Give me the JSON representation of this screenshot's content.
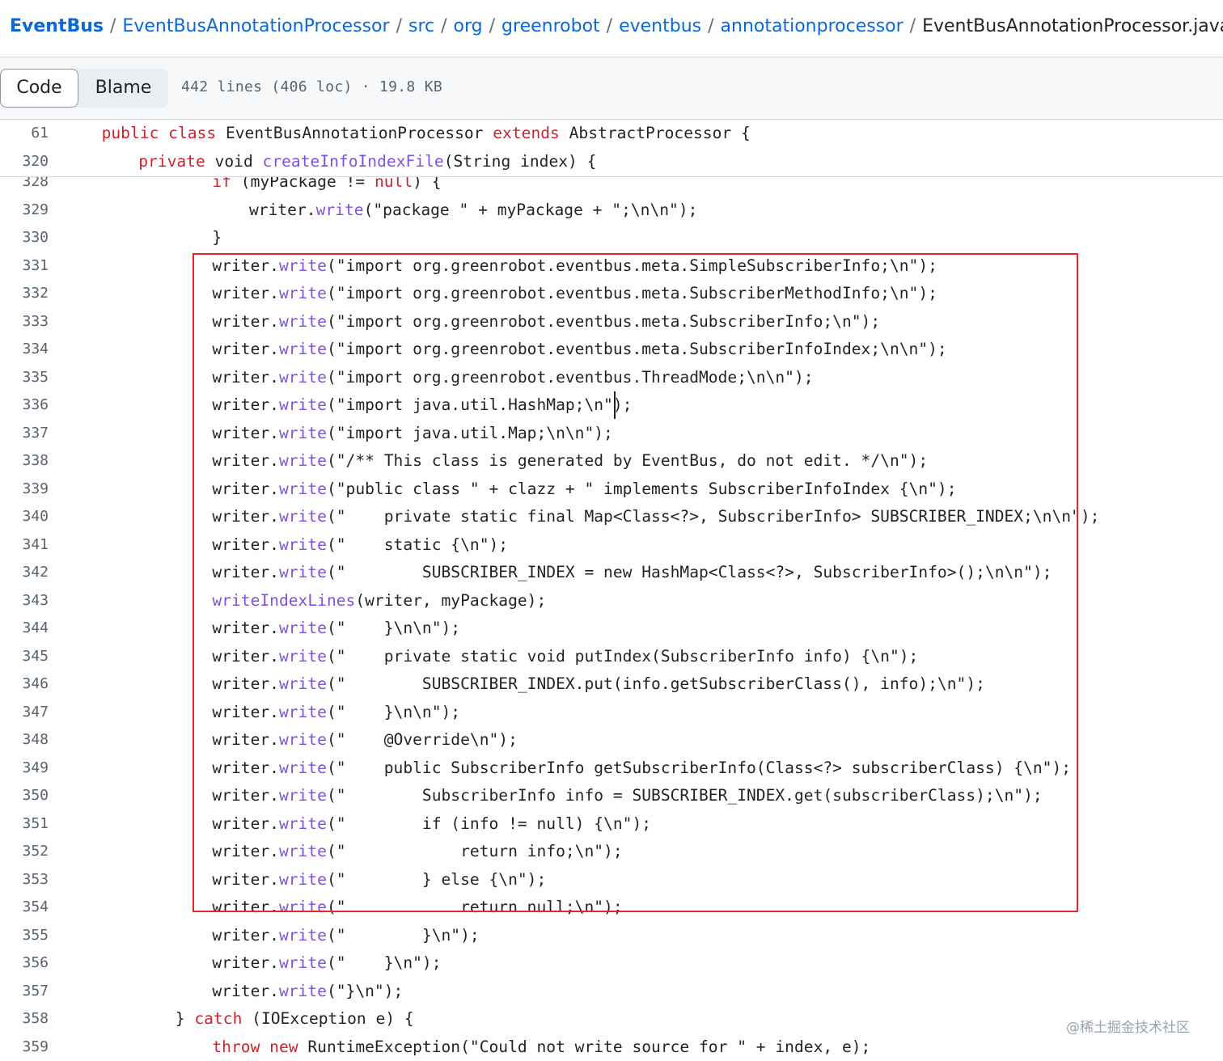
{
  "breadcrumb": {
    "items": [
      "EventBus",
      "EventBusAnnotationProcessor",
      "src",
      "org",
      "greenrobot",
      "eventbus",
      "annotationprocessor"
    ],
    "current": "EventBusAnnotationProcessor.java",
    "separator": "/"
  },
  "toolbar": {
    "code_tab": "Code",
    "blame_tab": "Blame",
    "file_meta": "442 lines (406 loc) · 19.8 KB"
  },
  "sticky_lines": [
    {
      "n": "61",
      "indent": 1,
      "tokens": [
        [
          "kw",
          "public"
        ],
        [
          "p",
          " "
        ],
        [
          "kw",
          "class"
        ],
        [
          "p",
          " EventBusAnnotationProcessor "
        ],
        [
          "kw",
          "extends"
        ],
        [
          "p",
          " AbstractProcessor {"
        ]
      ]
    },
    {
      "n": "320",
      "indent": 2,
      "tokens": [
        [
          "kw",
          "private"
        ],
        [
          "p",
          " void "
        ],
        [
          "fn",
          "createInfoIndexFile"
        ],
        [
          "p",
          "(String index) {"
        ]
      ]
    }
  ],
  "lines": [
    {
      "n": "328",
      "indent": 4,
      "tokens": [
        [
          "kw",
          "if"
        ],
        [
          "p",
          " (myPackage != "
        ],
        [
          "kw",
          "null"
        ],
        [
          "p",
          ") {"
        ]
      ]
    },
    {
      "n": "329",
      "indent": 5,
      "tokens": [
        [
          "p",
          "writer."
        ],
        [
          "fn",
          "write"
        ],
        [
          "p",
          "(\"package \" + myPackage + \";\\n\\n\");"
        ]
      ]
    },
    {
      "n": "330",
      "indent": 4,
      "tokens": [
        [
          "p",
          "}"
        ]
      ]
    },
    {
      "n": "331",
      "indent": 4,
      "tokens": [
        [
          "p",
          "writer."
        ],
        [
          "fn",
          "write"
        ],
        [
          "p",
          "(\"import org.greenrobot.eventbus.meta.SimpleSubscriberInfo;\\n\");"
        ]
      ]
    },
    {
      "n": "332",
      "indent": 4,
      "tokens": [
        [
          "p",
          "writer."
        ],
        [
          "fn",
          "write"
        ],
        [
          "p",
          "(\"import org.greenrobot.eventbus.meta.SubscriberMethodInfo;\\n\");"
        ]
      ]
    },
    {
      "n": "333",
      "indent": 4,
      "tokens": [
        [
          "p",
          "writer."
        ],
        [
          "fn",
          "write"
        ],
        [
          "p",
          "(\"import org.greenrobot.eventbus.meta.SubscriberInfo;\\n\");"
        ]
      ]
    },
    {
      "n": "334",
      "indent": 4,
      "tokens": [
        [
          "p",
          "writer."
        ],
        [
          "fn",
          "write"
        ],
        [
          "p",
          "(\"import org.greenrobot.eventbus.meta.SubscriberInfoIndex;\\n\\n\");"
        ]
      ]
    },
    {
      "n": "335",
      "indent": 4,
      "tokens": [
        [
          "p",
          "writer."
        ],
        [
          "fn",
          "write"
        ],
        [
          "p",
          "(\"import org.greenrobot.eventbus.ThreadMode;\\n\\n\");"
        ]
      ]
    },
    {
      "n": "336",
      "indent": 4,
      "tokens": [
        [
          "p",
          "writer."
        ],
        [
          "fn",
          "write"
        ],
        [
          "p",
          "(\"import java.util.HashMap;\\n\");"
        ]
      ]
    },
    {
      "n": "337",
      "indent": 4,
      "tokens": [
        [
          "p",
          "writer."
        ],
        [
          "fn",
          "write"
        ],
        [
          "p",
          "(\"import java.util.Map;\\n\\n\");"
        ]
      ]
    },
    {
      "n": "338",
      "indent": 4,
      "tokens": [
        [
          "p",
          "writer."
        ],
        [
          "fn",
          "write"
        ],
        [
          "p",
          "(\"/** This class is generated by EventBus, do not edit. */\\n\");"
        ]
      ]
    },
    {
      "n": "339",
      "indent": 4,
      "tokens": [
        [
          "p",
          "writer."
        ],
        [
          "fn",
          "write"
        ],
        [
          "p",
          "(\"public class \" + clazz + \" implements SubscriberInfoIndex {\\n\");"
        ]
      ]
    },
    {
      "n": "340",
      "indent": 4,
      "tokens": [
        [
          "p",
          "writer."
        ],
        [
          "fn",
          "write"
        ],
        [
          "p",
          "(\"    private static final Map<Class<?>, SubscriberInfo> SUBSCRIBER_INDEX;\\n\\n\");"
        ]
      ]
    },
    {
      "n": "341",
      "indent": 4,
      "tokens": [
        [
          "p",
          "writer."
        ],
        [
          "fn",
          "write"
        ],
        [
          "p",
          "(\"    static {\\n\");"
        ]
      ]
    },
    {
      "n": "342",
      "indent": 4,
      "tokens": [
        [
          "p",
          "writer."
        ],
        [
          "fn",
          "write"
        ],
        [
          "p",
          "(\"        SUBSCRIBER_INDEX = new HashMap<Class<?>, SubscriberInfo>();\\n\\n\");"
        ]
      ]
    },
    {
      "n": "343",
      "indent": 4,
      "tokens": [
        [
          "fn",
          "writeIndexLines"
        ],
        [
          "p",
          "(writer, myPackage);"
        ]
      ]
    },
    {
      "n": "344",
      "indent": 4,
      "tokens": [
        [
          "p",
          "writer."
        ],
        [
          "fn",
          "write"
        ],
        [
          "p",
          "(\"    }\\n\\n\");"
        ]
      ]
    },
    {
      "n": "345",
      "indent": 4,
      "tokens": [
        [
          "p",
          "writer."
        ],
        [
          "fn",
          "write"
        ],
        [
          "p",
          "(\"    private static void putIndex(SubscriberInfo info) {\\n\");"
        ]
      ]
    },
    {
      "n": "346",
      "indent": 4,
      "tokens": [
        [
          "p",
          "writer."
        ],
        [
          "fn",
          "write"
        ],
        [
          "p",
          "(\"        SUBSCRIBER_INDEX.put(info.getSubscriberClass(), info);\\n\");"
        ]
      ]
    },
    {
      "n": "347",
      "indent": 4,
      "tokens": [
        [
          "p",
          "writer."
        ],
        [
          "fn",
          "write"
        ],
        [
          "p",
          "(\"    }\\n\\n\");"
        ]
      ]
    },
    {
      "n": "348",
      "indent": 4,
      "tokens": [
        [
          "p",
          "writer."
        ],
        [
          "fn",
          "write"
        ],
        [
          "p",
          "(\"    @Override\\n\");"
        ]
      ]
    },
    {
      "n": "349",
      "indent": 4,
      "tokens": [
        [
          "p",
          "writer."
        ],
        [
          "fn",
          "write"
        ],
        [
          "p",
          "(\"    public SubscriberInfo getSubscriberInfo(Class<?> subscriberClass) {\\n\");"
        ]
      ]
    },
    {
      "n": "350",
      "indent": 4,
      "tokens": [
        [
          "p",
          "writer."
        ],
        [
          "fn",
          "write"
        ],
        [
          "p",
          "(\"        SubscriberInfo info = SUBSCRIBER_INDEX.get(subscriberClass);\\n\");"
        ]
      ]
    },
    {
      "n": "351",
      "indent": 4,
      "tokens": [
        [
          "p",
          "writer."
        ],
        [
          "fn",
          "write"
        ],
        [
          "p",
          "(\"        if (info != null) {\\n\");"
        ]
      ]
    },
    {
      "n": "352",
      "indent": 4,
      "tokens": [
        [
          "p",
          "writer."
        ],
        [
          "fn",
          "write"
        ],
        [
          "p",
          "(\"            return info;\\n\");"
        ]
      ]
    },
    {
      "n": "353",
      "indent": 4,
      "tokens": [
        [
          "p",
          "writer."
        ],
        [
          "fn",
          "write"
        ],
        [
          "p",
          "(\"        } else {\\n\");"
        ]
      ]
    },
    {
      "n": "354",
      "indent": 4,
      "tokens": [
        [
          "p",
          "writer."
        ],
        [
          "fn",
          "write"
        ],
        [
          "p",
          "(\"            return null;\\n\");"
        ]
      ]
    },
    {
      "n": "355",
      "indent": 4,
      "tokens": [
        [
          "p",
          "writer."
        ],
        [
          "fn",
          "write"
        ],
        [
          "p",
          "(\"        }\\n\");"
        ]
      ]
    },
    {
      "n": "356",
      "indent": 4,
      "tokens": [
        [
          "p",
          "writer."
        ],
        [
          "fn",
          "write"
        ],
        [
          "p",
          "(\"    }\\n\");"
        ]
      ]
    },
    {
      "n": "357",
      "indent": 4,
      "tokens": [
        [
          "p",
          "writer."
        ],
        [
          "fn",
          "write"
        ],
        [
          "p",
          "(\"}\\n\");"
        ]
      ]
    },
    {
      "n": "358",
      "indent": 3,
      "tokens": [
        [
          "p",
          "} "
        ],
        [
          "kw",
          "catch"
        ],
        [
          "p",
          " (IOException e) {"
        ]
      ]
    },
    {
      "n": "359",
      "indent": 4,
      "tokens": [
        [
          "kw",
          "throw"
        ],
        [
          "p",
          " "
        ],
        [
          "kw",
          "new"
        ],
        [
          "p",
          " RuntimeException(\"Could not write source for \" + index, e);"
        ]
      ]
    }
  ],
  "watermark": "@稀土掘金技术社区",
  "colors": {
    "keyword": "#cf222e",
    "function": "#8250df",
    "link": "#0969da",
    "highlight_border": "#e8242c"
  }
}
